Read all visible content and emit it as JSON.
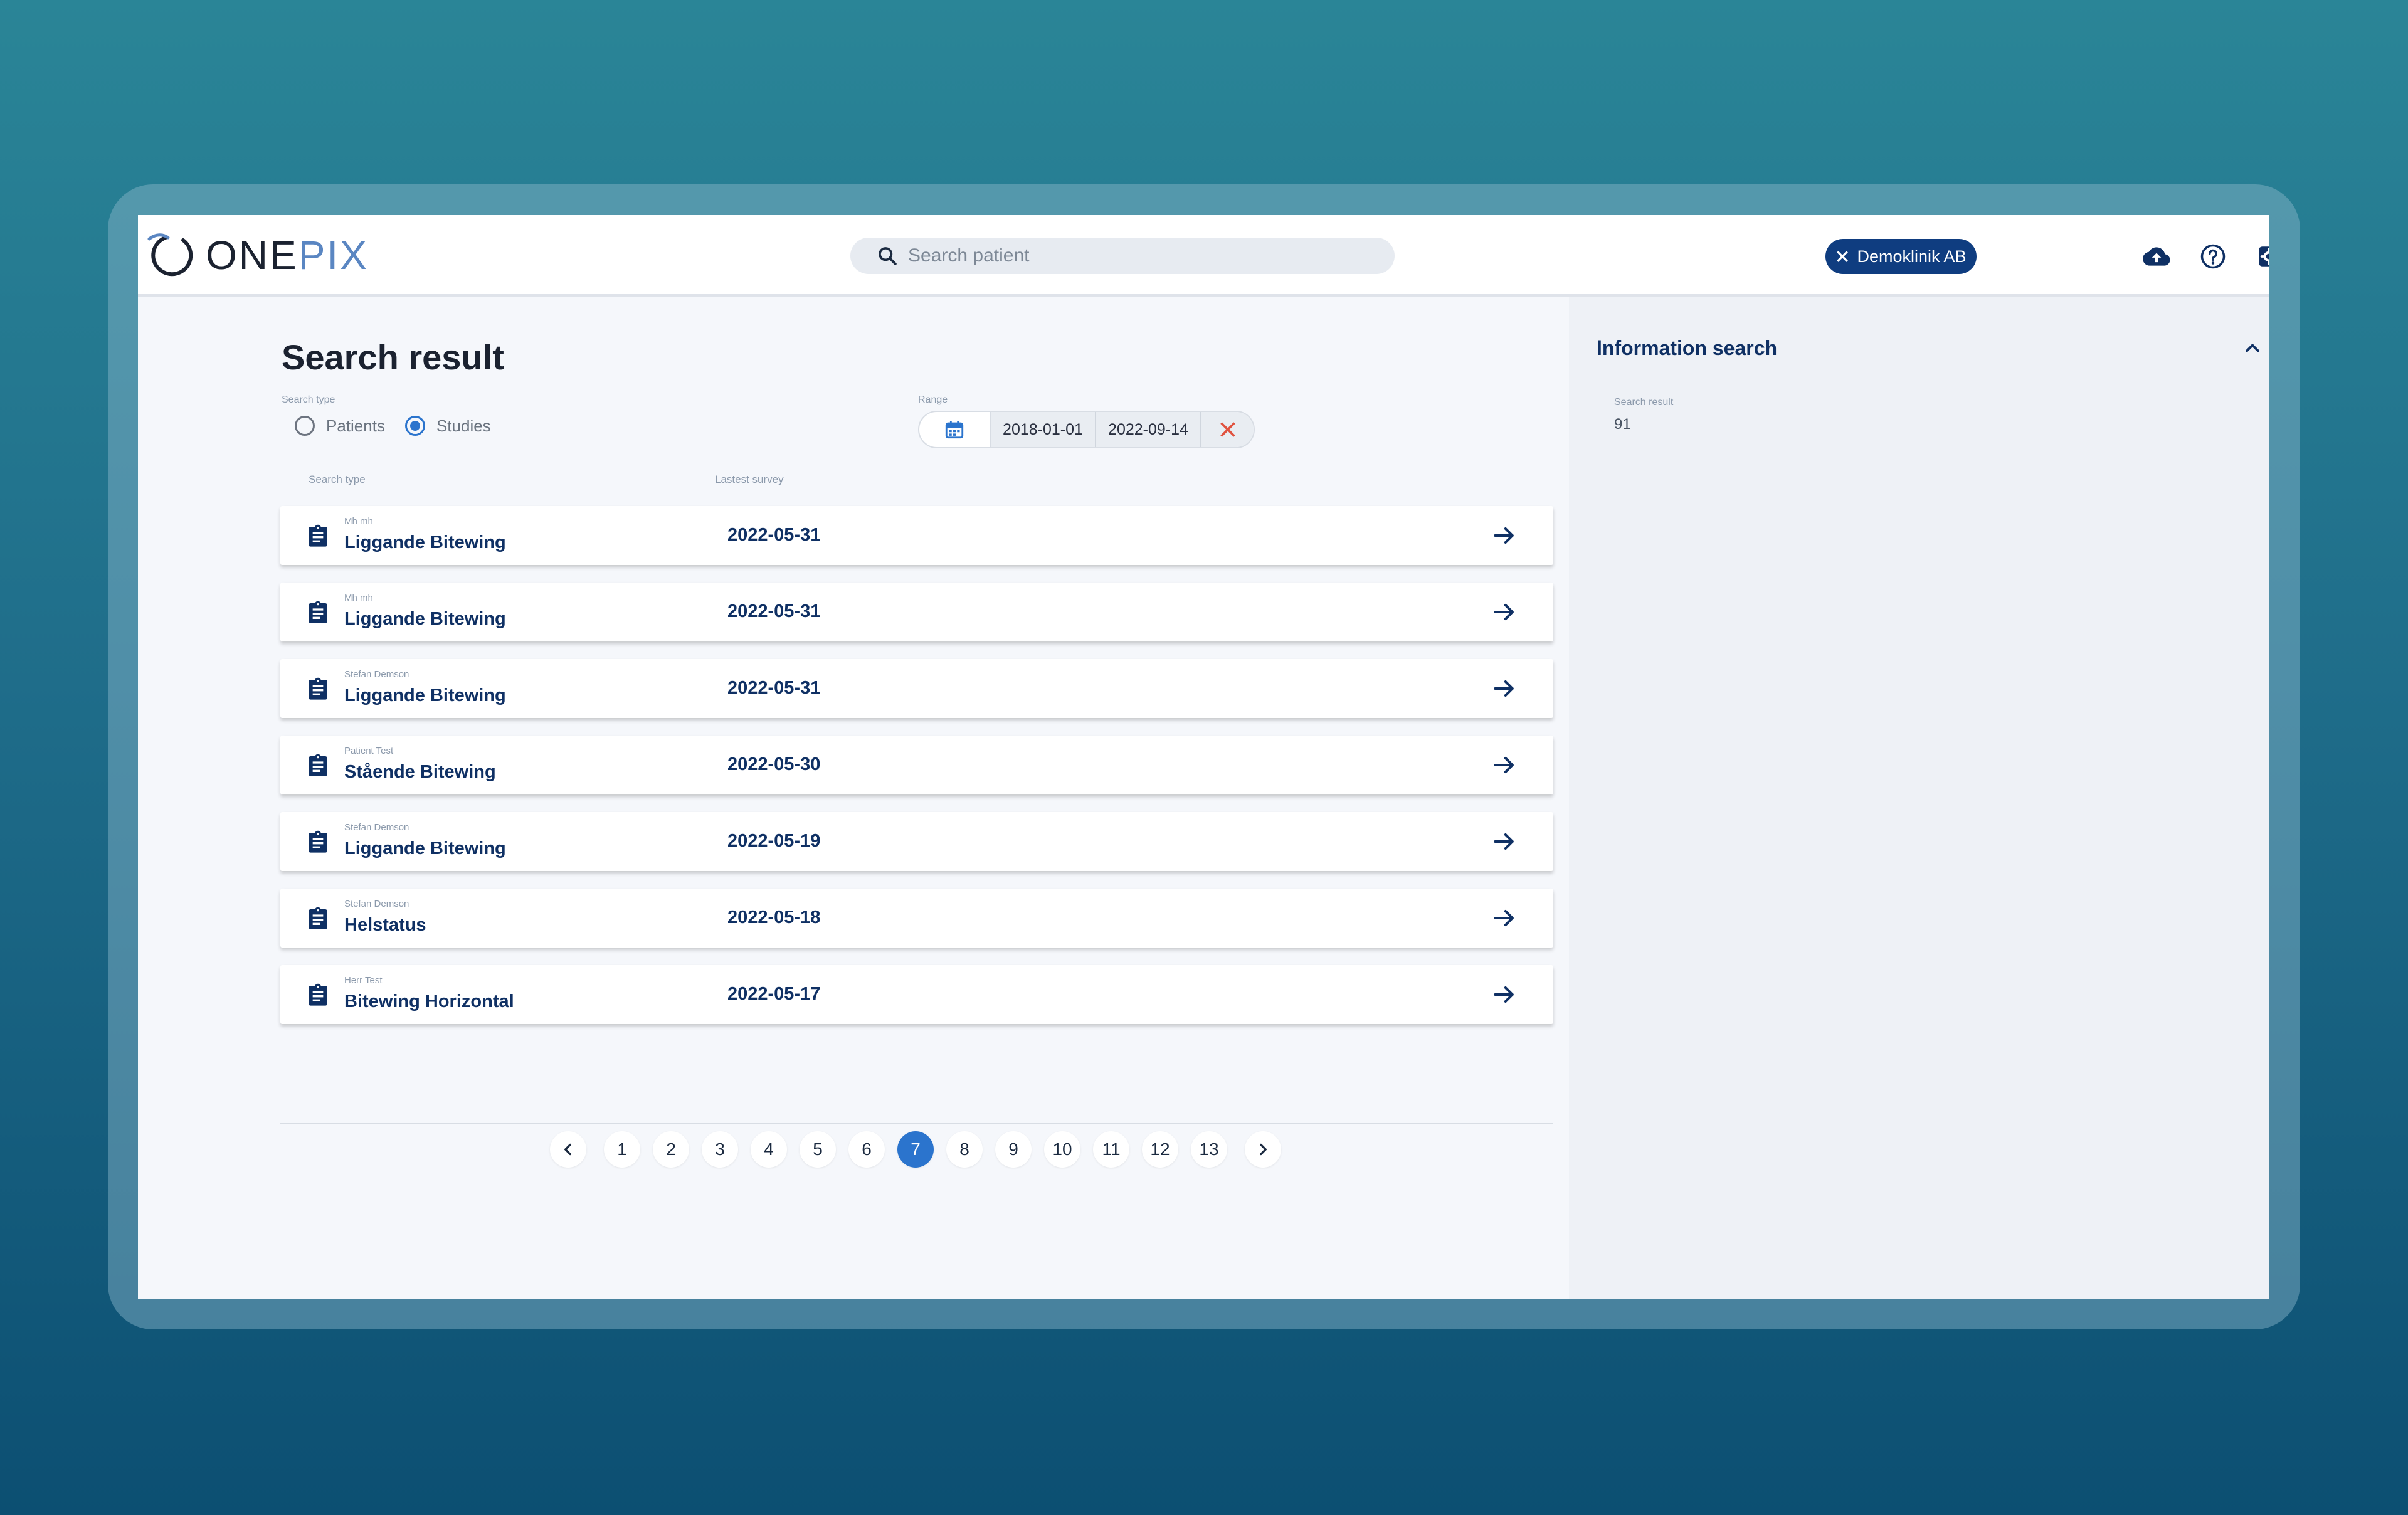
{
  "header": {
    "logo_one": "ONE",
    "logo_pix": "PIX",
    "search_placeholder": "Search patient",
    "clinic_chip": "Demoklinik AB",
    "icons": [
      "cloud-upload-icon",
      "help-icon",
      "settings-icon",
      "globe-icon",
      "user-icon"
    ]
  },
  "main": {
    "title": "Search result",
    "search_type_label": "Search type",
    "radio": {
      "patients": "Patients",
      "studies": "Studies",
      "selected": "studies"
    },
    "range_label": "Range",
    "range_from": "2018-01-01",
    "range_to": "2022-09-14",
    "columns": {
      "type": "Search type",
      "latest": "Lastest survey"
    },
    "rows": [
      {
        "patient": "Mh mh",
        "title": "Liggande Bitewing",
        "date": "2022-05-31"
      },
      {
        "patient": "Mh mh",
        "title": "Liggande Bitewing",
        "date": "2022-05-31"
      },
      {
        "patient": "Stefan Demson",
        "title": "Liggande Bitewing",
        "date": "2022-05-31"
      },
      {
        "patient": "Patient Test",
        "title": "Stående Bitewing",
        "date": "2022-05-30"
      },
      {
        "patient": "Stefan Demson",
        "title": "Liggande Bitewing",
        "date": "2022-05-19"
      },
      {
        "patient": "Stefan Demson",
        "title": "Helstatus",
        "date": "2022-05-18"
      },
      {
        "patient": "Herr Test",
        "title": "Bitewing Horizontal",
        "date": "2022-05-17"
      }
    ],
    "pagination": {
      "pages": [
        "1",
        "2",
        "3",
        "4",
        "5",
        "6",
        "7",
        "8",
        "9",
        "10",
        "11",
        "12",
        "13"
      ],
      "current": "7"
    }
  },
  "side": {
    "title": "Information search",
    "result_label": "Search result",
    "result_value": "91"
  },
  "colors": {
    "accent": "#2b74cd",
    "navy": "#0f3d80",
    "text_dark": "#0f3064",
    "danger": "#e0523f"
  }
}
